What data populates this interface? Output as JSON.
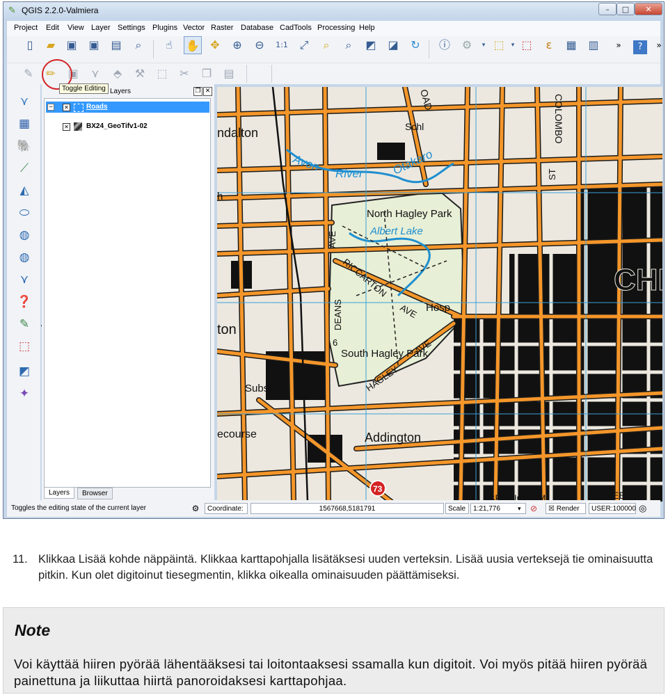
{
  "window": {
    "title": "QGIS 2.2.0-Valmiera",
    "app_icon": "qgis-icon",
    "minimize": "–",
    "maximize": "□",
    "close": "✕"
  },
  "menu": [
    "Project",
    "Edit",
    "View",
    "Layer",
    "Settings",
    "Plugins",
    "Vector",
    "Raster",
    "Database",
    "CadTools",
    "Processing",
    "Help"
  ],
  "toolbar": {
    "tooltip": "Toggle Editing",
    "more": "»",
    "help": "?"
  },
  "layers_panel": {
    "title": "Layers",
    "float_btn": "❐",
    "close_btn": "✕",
    "layers": [
      {
        "name": "Roads",
        "checked": true,
        "selected": true
      },
      {
        "name": "BX24_GeoTifv1-02",
        "checked": true,
        "selected": false
      }
    ],
    "tabs": [
      "Layers",
      "Browser"
    ]
  },
  "map": {
    "labels": {
      "dalton": "ndalton",
      "colombo": "COLOMBO",
      "schl": "Schl",
      "oad": "OAD",
      "avon": "Avon",
      "river": "River",
      "otakaro": "Otakaro",
      "north_hagley": "North Hagley Park",
      "albert_lake": "Albert Lake",
      "ave_vert": "AVE",
      "riccarton": "RICCARTON",
      "ave2": "AVE",
      "hosp": "Hosp",
      "deans": "DEANS",
      "chr": "CHR",
      "south_hagley": "South Hagley Park",
      "ave3": "AVE",
      "hagley": "HAGLEY",
      "num6": "6",
      "substn": "Substn",
      "ton": "ton",
      "course": "ecourse",
      "addington": "Addington",
      "st": "ST",
      "sh73": "73",
      "brougham": "BROUGHAM",
      "street": "STREET",
      "h": "h"
    },
    "colors": {
      "road": "#f4962a",
      "road_edge": "#1a1a1a",
      "park": "#e7efd6",
      "water": "#1f8fd0",
      "grid": "#3aa0d8",
      "building": "#111111",
      "background": "#ece8df"
    }
  },
  "status": {
    "message": "Toggles the editing state of the current layer",
    "coordinate_label": "Coordinate:",
    "coordinate_value": "1567668,5181791",
    "scale_label": "Scale",
    "scale_value": "1:21,776",
    "render_label": "Render",
    "crs": "USER:100000"
  },
  "doc": {
    "step_number": "11.",
    "step_text": "Klikkaa Lisää kohde näppäintä. Klikkaa karttapohjalla lisätäksesi uuden verteksin. Lisää uusia verteksejä tie ominaisuutta pitkin. Kun olet digitoinut tiesegmentin, klikka oikealla ominaisuuden päättämiseksi.",
    "note_title": "Note",
    "note_text": "Voi käyttää hiiren pyörää lähentääksesi tai loitontaaksesi ssamalla kun digitoit. Voi myös pitää hiiren pyörää painettuna ja liikuttaa hiirtä panoroidaksesi karttapohjaa."
  }
}
